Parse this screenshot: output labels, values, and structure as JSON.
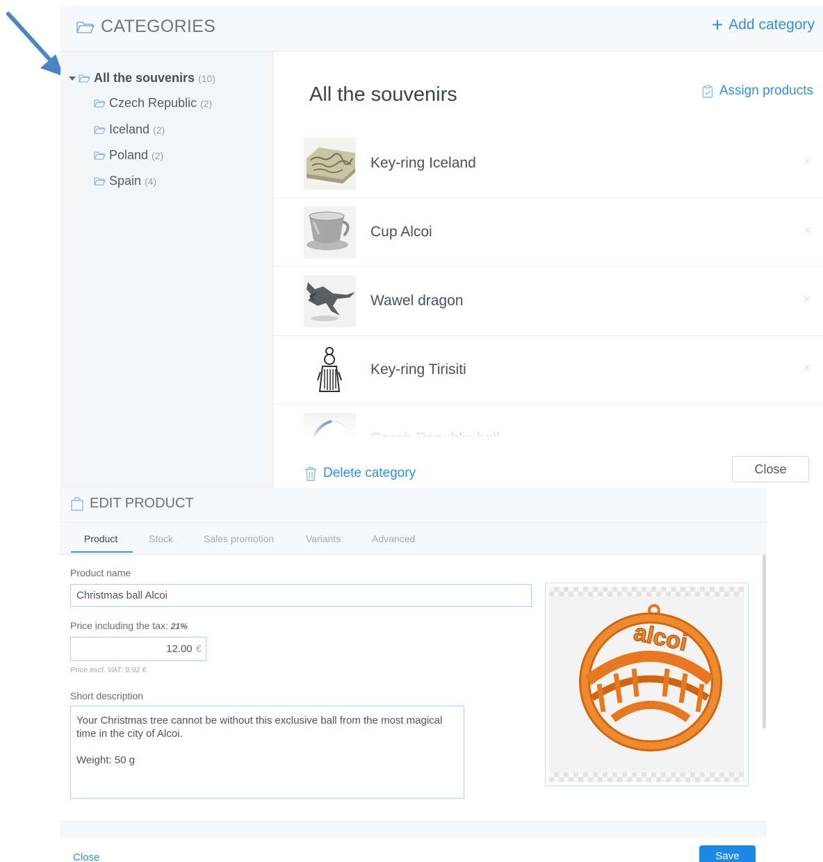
{
  "categories_panel": {
    "title": "CATEGORIES",
    "add_category_label": "Add category",
    "tree": {
      "root": {
        "label": "All the souvenirs",
        "count": "(10)"
      },
      "children": [
        {
          "label": "Czech Republic",
          "count": "(2)"
        },
        {
          "label": "Iceland",
          "count": "(2)"
        },
        {
          "label": "Poland",
          "count": "(2)"
        },
        {
          "label": "Spain",
          "count": "(4)"
        }
      ]
    },
    "selected_category_title": "All the souvenirs",
    "assign_products_label": "Assign products",
    "products": [
      {
        "name": "Key-ring Iceland",
        "remove": "×"
      },
      {
        "name": "Cup Alcoi",
        "remove": "×"
      },
      {
        "name": "Wawel dragon",
        "remove": "×"
      },
      {
        "name": "Key-ring Tirisiti",
        "remove": "×"
      },
      {
        "name": "Czech Republic ball",
        "remove": "×"
      }
    ],
    "delete_category_label": "Delete category",
    "close_label": "Close"
  },
  "edit_product": {
    "title": "EDIT PRODUCT",
    "tabs": [
      {
        "label": "Product",
        "active": true
      },
      {
        "label": "Stock",
        "active": false
      },
      {
        "label": "Sales promotion",
        "active": false
      },
      {
        "label": "Variants",
        "active": false
      },
      {
        "label": "Advanced",
        "active": false
      }
    ],
    "product_name_label": "Product name",
    "product_name_value": "Christmas ball Alcoi",
    "price_label": "Price including the tax:",
    "tax_rate": "21%",
    "price_value": "12.00",
    "currency": "€",
    "price_excl_vat": "Price excl. VAT: 9.92 €",
    "short_description_label": "Short description",
    "short_description_value": "Your Christmas tree cannot be without this exclusive ball from the most magical time in the city of Alcoi.\n\nWeight: 50 g",
    "image_text": "alcoi",
    "close_label": "Close",
    "save_label": "Save"
  },
  "colors": {
    "accent": "#2f8fd8",
    "save_button": "#1e88e5",
    "arrow": "#4a86c5",
    "ornament": "#e87722"
  }
}
